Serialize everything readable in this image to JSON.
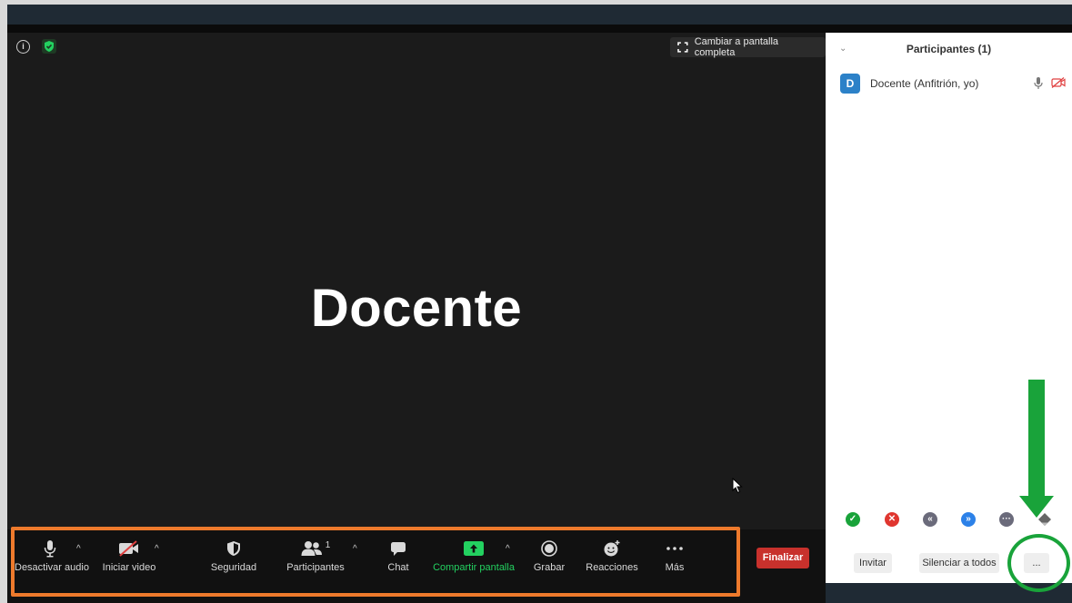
{
  "video": {
    "participant_name": "Docente",
    "fullscreen_label": "Cambiar a pantalla completa"
  },
  "toolbar": {
    "audio_label": "Desactivar audio",
    "video_label": "Iniciar video",
    "security_label": "Seguridad",
    "participants_label": "Participantes",
    "participants_count": "1",
    "chat_label": "Chat",
    "share_label": "Compartir pantalla",
    "record_label": "Grabar",
    "reactions_label": "Reacciones",
    "more_label": "Más",
    "end_label": "Finalizar"
  },
  "panel": {
    "title": "Participantes (1)",
    "participants": [
      {
        "initial": "D",
        "name": "Docente (Anfitrión, yo)"
      }
    ],
    "invite_label": "Invitar",
    "mute_all_label": "Silenciar a todos",
    "more_label": "..."
  },
  "colors": {
    "accent_green": "#23d160",
    "end_red": "#c8312c",
    "highlight_orange": "#ee7a2c",
    "annotation_green": "#19a33a",
    "avatar_blue": "#2c81c8"
  },
  "icons": {
    "reactions": [
      "check-icon",
      "x-icon",
      "slower-icon",
      "faster-icon",
      "more-dots-icon",
      "eraser-icon"
    ]
  }
}
